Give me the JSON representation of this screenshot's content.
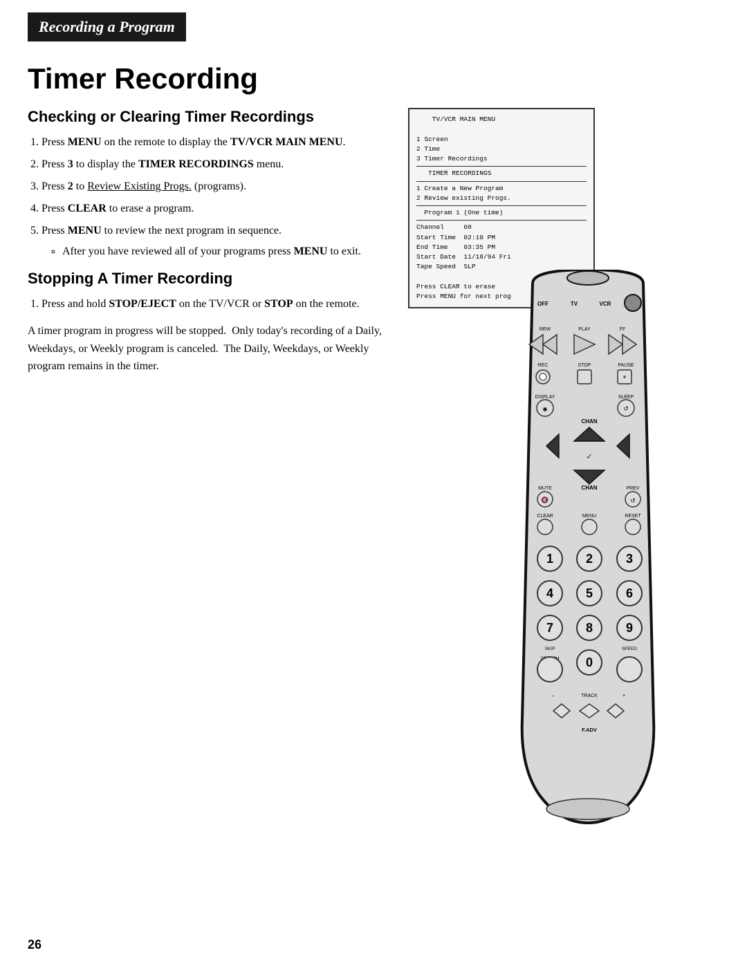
{
  "header": {
    "bar_label": "Recording a Program"
  },
  "page_title": "Timer Recording",
  "sections": [
    {
      "id": "section1",
      "title": "Checking or Clearing Timer Recordings",
      "steps": [
        "Press MENU on the remote to display the TV/VCR MAIN MENU.",
        "Press 3 to display the TIMER RECORDINGS menu.",
        "Press 2 to Review Existing Progs. (programs).",
        "Press CLEAR to erase a program.",
        "Press MENU to review the next program in sequence."
      ],
      "bullet": "After you have reviewed all of your programs press MENU to exit."
    },
    {
      "id": "section2",
      "title": "Stopping A Timer Recording",
      "steps": [
        "Press and hold STOP/EJECT on the TV/VCR or STOP on the remote."
      ],
      "paragraph": "A timer program in progress will be stopped.  Only today's recording of a Daily, Weekdays, or Weekly program is canceled.  The Daily, Weekdays, or Weekly program remains in the timer."
    }
  ],
  "tv_screen": {
    "lines": [
      "    TV/VCR MAIN MENU",
      "",
      "1 Screen",
      "2 Time",
      "3 Timer Recordings",
      "--- TIMER RECORDINGS ---",
      "",
      "1 Create a New Program",
      "2 Review existing Progs.",
      "--- Program 1 (One time) ---",
      "",
      "Channel     08",
      "Start Time  02:10 PM",
      "End Time    03:35 PM",
      "Start Date  11/18/94 Fri",
      "Tape Speed  SLP",
      "",
      "Press CLEAR to erase",
      "Press MENU for next prog"
    ]
  },
  "remote": {
    "buttons": {
      "off": "OFF",
      "tv": "TV",
      "vcr": "VCR",
      "rew": "REW",
      "play": "PLAY",
      "ff": "FF",
      "rec": "REC",
      "stop": "STOP",
      "pause": "PAUSE",
      "display": "DISPLAY",
      "sleep": "SLEEP",
      "chan_up": "▲",
      "chan_down": "▼",
      "vol_up": "▲",
      "vol_down": "▼",
      "mute": "MUTE",
      "chan_label": "CHAN",
      "prev": "PREV",
      "clear": "CLEAR",
      "menu": "MENU",
      "reset": "RESET",
      "num1": "1",
      "num2": "2",
      "num3": "3",
      "num4": "4",
      "num5": "5",
      "num6": "6",
      "num7": "7",
      "num8": "8",
      "num9": "9",
      "num0": "0",
      "skip": "SKIP",
      "search": "SEARCH",
      "speed": "SPEED",
      "track_minus": "–",
      "track_label": "TRACK",
      "track_plus": "+",
      "fadv": "F.ADV"
    }
  },
  "page_number": "26"
}
